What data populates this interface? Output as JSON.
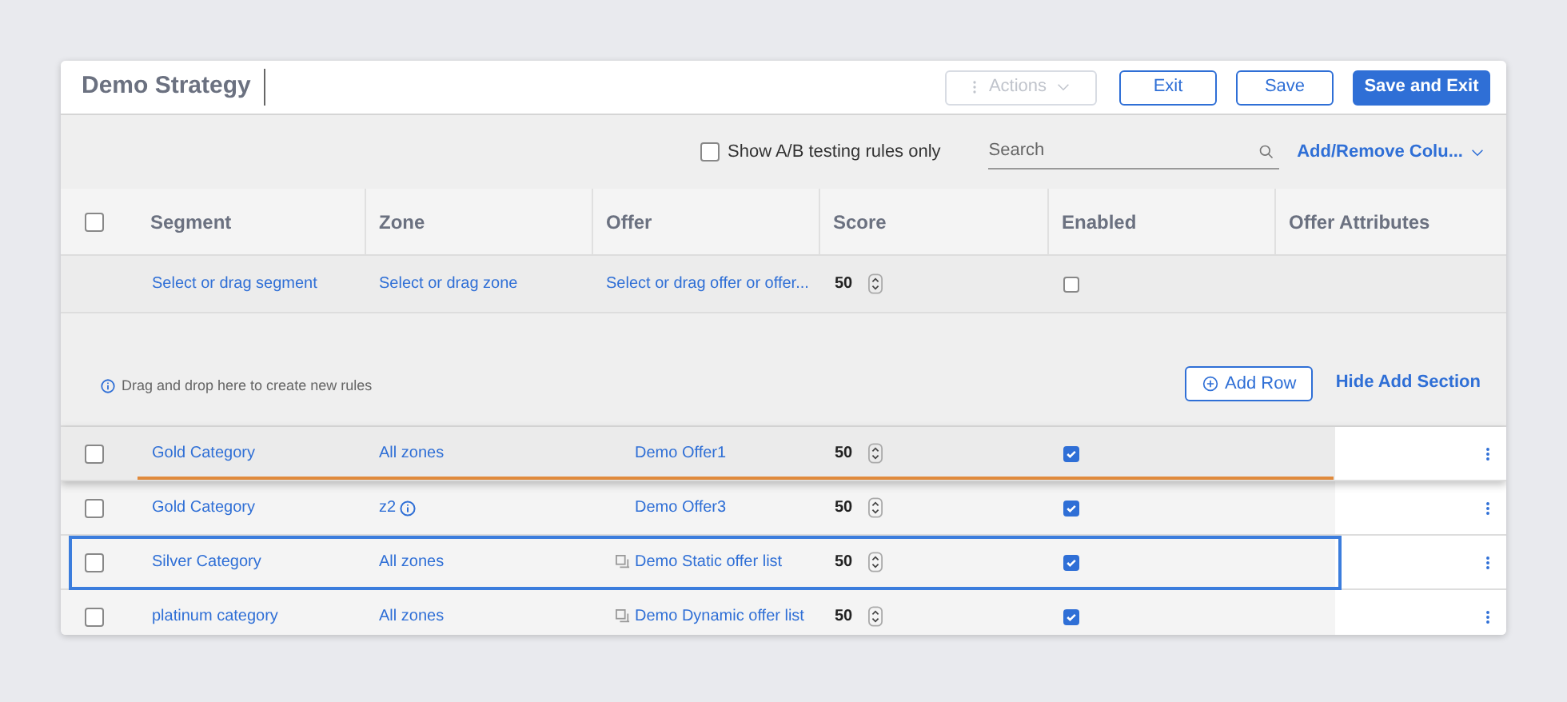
{
  "header": {
    "title": "Demo Strategy",
    "buttons": [
      {
        "label": "Actions",
        "kind": "menu",
        "disabled": true
      },
      {
        "label": "Exit",
        "kind": "outline",
        "disabled": false
      },
      {
        "label": "Save",
        "kind": "outline",
        "disabled": false
      },
      {
        "label": "Save and Exit",
        "kind": "primary",
        "disabled": false
      }
    ]
  },
  "toolbar": {
    "ab_filter": {
      "label": "Show A/B testing rules only",
      "checked": false
    },
    "search": {
      "placeholder": "Search"
    },
    "columns_link": "Add/Remove Colu..."
  },
  "table": {
    "select_all": {
      "checked": false
    },
    "columns": [
      "Segment",
      "Zone",
      "Offer",
      "Score",
      "Enabled",
      "Offer Attributes"
    ],
    "new_rule": {
      "segment": "Select or drag segment",
      "zone": "Select or drag zone",
      "offer": "Select or drag offer or offer...",
      "score": "50",
      "enabled": false
    },
    "add_section": {
      "hint": "Drag and drop here to create new rules",
      "add_button": "Add Row",
      "hide_link": "Hide Add Section"
    },
    "rows": [
      {
        "checked": false,
        "segment": "Gold Category",
        "zone": "All zones",
        "zone_info": false,
        "offer": "Demo Offer1",
        "offer_is_list": false,
        "score": "50",
        "enabled": true,
        "dragging": true,
        "selected": false
      },
      {
        "checked": false,
        "segment": "Gold Category",
        "zone": "z2",
        "zone_info": true,
        "offer": "Demo Offer3",
        "offer_is_list": false,
        "score": "50",
        "enabled": true,
        "dragging": false,
        "selected": false
      },
      {
        "checked": false,
        "segment": "Silver Category",
        "zone": "All zones",
        "zone_info": false,
        "offer": "Demo Static offer list",
        "offer_is_list": true,
        "score": "50",
        "enabled": true,
        "dragging": false,
        "selected": true
      },
      {
        "checked": false,
        "segment": "platinum category",
        "zone": "All zones",
        "zone_info": false,
        "offer": "Demo Dynamic offer list",
        "offer_is_list": true,
        "score": "50",
        "enabled": true,
        "dragging": false,
        "selected": false
      }
    ]
  }
}
